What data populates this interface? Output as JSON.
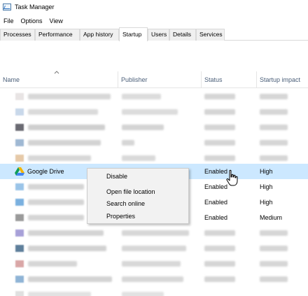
{
  "window": {
    "title": "Task Manager"
  },
  "menu": [
    "File",
    "Options",
    "View"
  ],
  "tabs": [
    {
      "label": "Processes"
    },
    {
      "label": "Performance"
    },
    {
      "label": "App history"
    },
    {
      "label": "Startup",
      "active": true
    },
    {
      "label": "Users"
    },
    {
      "label": "Details"
    },
    {
      "label": "Services"
    }
  ],
  "table": {
    "headers": {
      "name": "Name",
      "publisher": "Publisher",
      "status": "Status",
      "impact": "Startup impact"
    },
    "selected_row": {
      "name": "Google Drive",
      "status": "Enabled",
      "impact": "High"
    },
    "visible_rows": [
      {
        "status": "Enabled",
        "impact": "High"
      },
      {
        "status": "Enabled",
        "impact": "High"
      },
      {
        "status": "Enabled",
        "impact": "Medium"
      }
    ]
  },
  "context_menu": {
    "items": [
      "Disable",
      "Open file location",
      "Search online",
      "Properties"
    ]
  },
  "colors": {
    "selection": "#cce8ff",
    "header_text": "#4c607a",
    "menu_bg": "#f2f2f2"
  },
  "icons": [
    "task-manager-icon",
    "google-drive-icon",
    "hand-cursor-icon",
    "sort-up-icon"
  ]
}
